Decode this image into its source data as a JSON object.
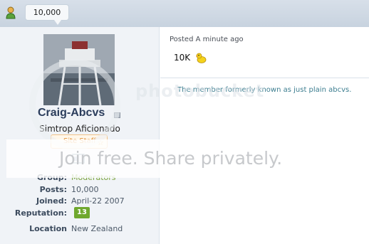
{
  "header": {
    "post_count": "10,000",
    "user_icon": "user-icon"
  },
  "user": {
    "avatar_icon": "lighthouse-photo",
    "username": "Craig-Abcvs",
    "status_icon": "offline-icon",
    "title": "Simtrop Aficionado",
    "badge": "Site Staff",
    "badge_icon": "star-icon",
    "rank_icon": "book-icon"
  },
  "profile": {
    "group_label": "Group:",
    "group_value": "Moderators",
    "posts_label": "Posts:",
    "posts_value": "10,000",
    "joined_label": "Joined:",
    "joined_value": "April-22 2007",
    "rep_label": "Reputation:",
    "rep_value": "13",
    "location_label": "Location",
    "location_value": "New Zealand"
  },
  "post": {
    "meta": "Posted A minute ago",
    "body": "10K",
    "emoji_icon": "duck-icon",
    "signature": "The member formerly known as just plain abcvs."
  },
  "watermark": {
    "logo": "photobucket",
    "banner": "Join free. Share privately."
  },
  "colors": {
    "header": "#d7dfe9",
    "sidebar": "#f0f3f7",
    "username": "#2b3d5c",
    "moderators": "#7aa33a",
    "reputation": "#6fa82e",
    "signature": "#3c7d8f",
    "badge": "#e28a2b"
  }
}
